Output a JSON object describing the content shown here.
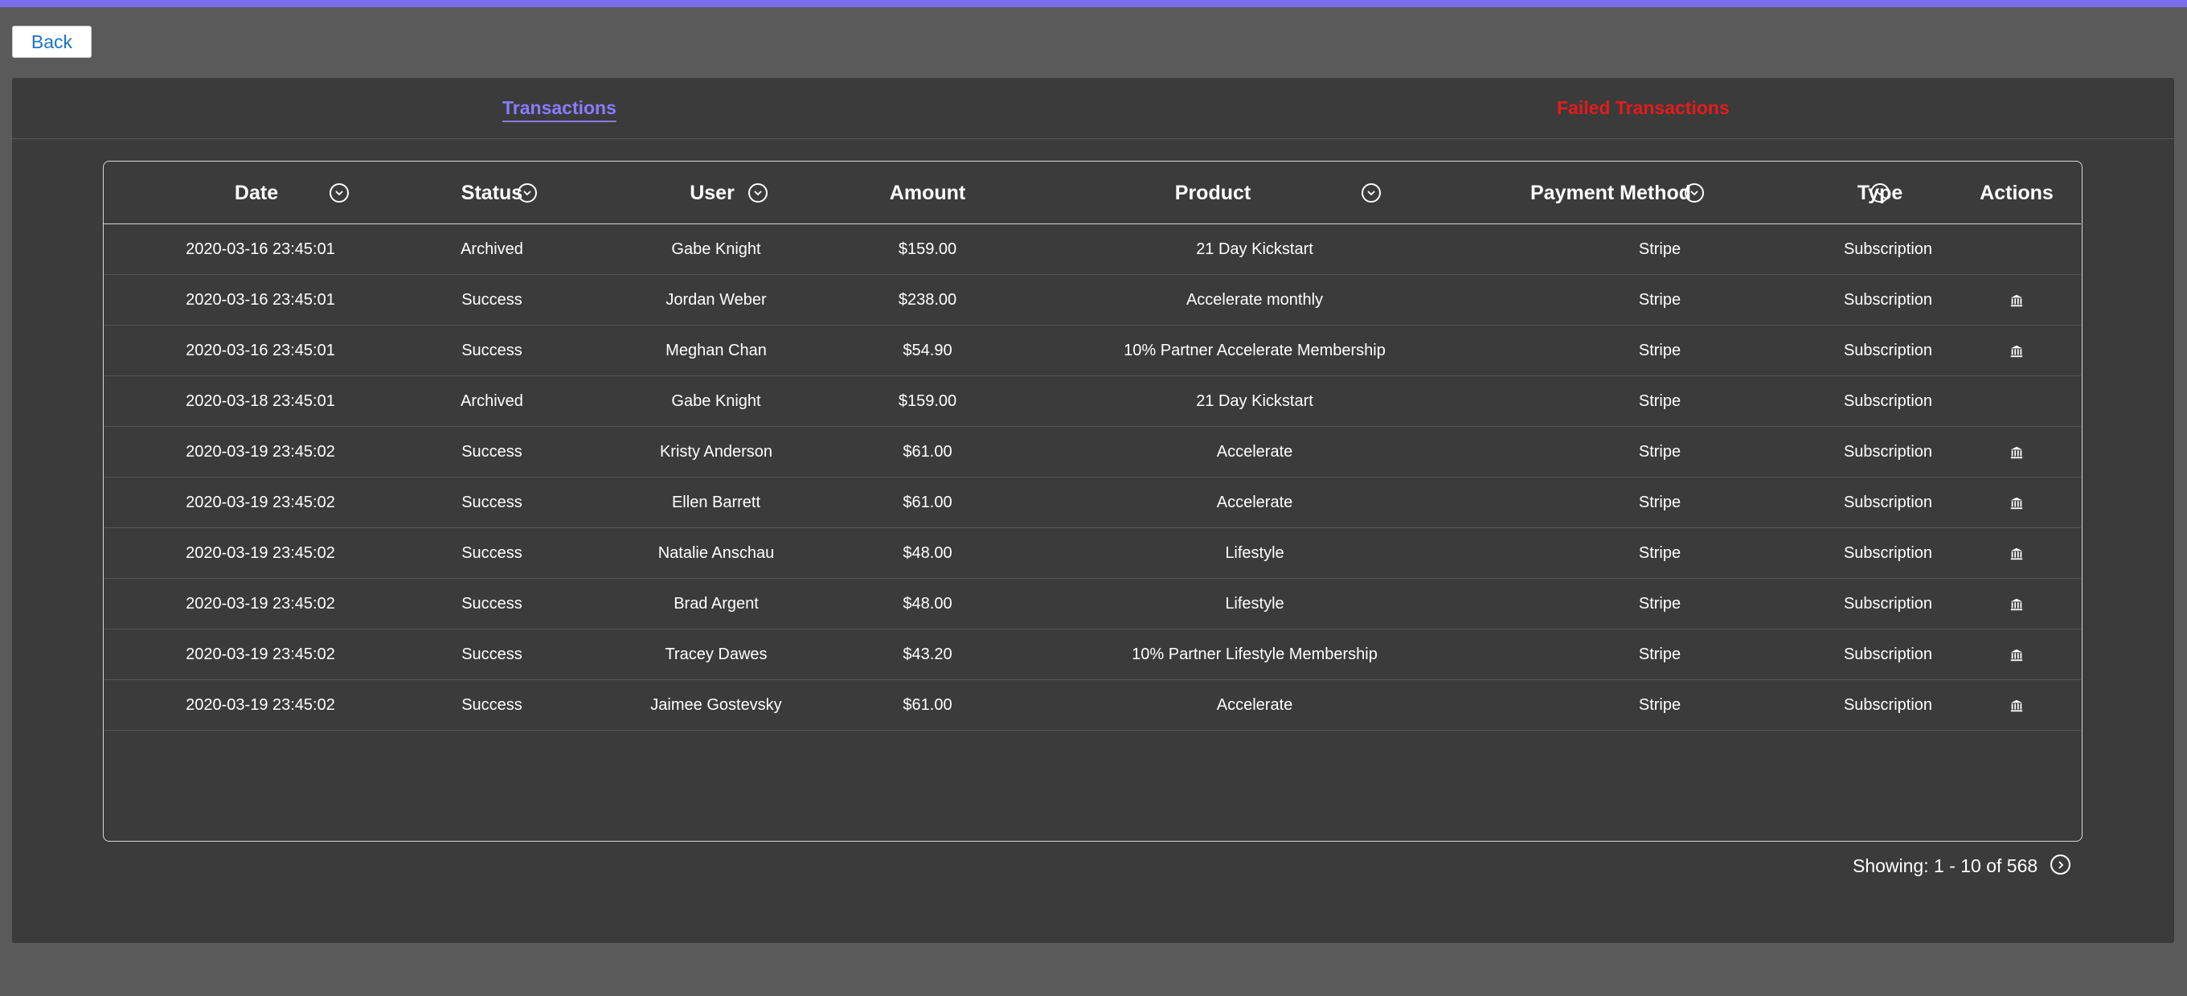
{
  "back_label": "Back",
  "tabs": [
    {
      "label": "Transactions",
      "active": true
    },
    {
      "label": "Failed Transactions",
      "active": false
    }
  ],
  "colors": {
    "accent": "#7b6cf0",
    "failed": "#e51b1b",
    "panel": "#3b3b3b",
    "page": "#5a5a5a"
  },
  "table": {
    "headers": {
      "date": "Date",
      "status": "Status",
      "user": "User",
      "amount": "Amount",
      "product": "Product",
      "payment_method": "Payment Method",
      "type": "Type",
      "actions": "Actions"
    },
    "sortable_icon": "chevron-down-circle-icon",
    "action_icon": "bank-icon",
    "rows": [
      {
        "date": "2020-03-16 23:45:01",
        "status": "Archived",
        "user": "Gabe Knight",
        "amount": "$159.00",
        "product": "21 Day Kickstart",
        "payment_method": "Stripe",
        "type": "Subscription",
        "has_action": false
      },
      {
        "date": "2020-03-16 23:45:01",
        "status": "Success",
        "user": "Jordan Weber",
        "amount": "$238.00",
        "product": "Accelerate monthly",
        "payment_method": "Stripe",
        "type": "Subscription",
        "has_action": true
      },
      {
        "date": "2020-03-16 23:45:01",
        "status": "Success",
        "user": "Meghan Chan",
        "amount": "$54.90",
        "product": "10% Partner Accelerate Membership",
        "payment_method": "Stripe",
        "type": "Subscription",
        "has_action": true
      },
      {
        "date": "2020-03-18 23:45:01",
        "status": "Archived",
        "user": "Gabe Knight",
        "amount": "$159.00",
        "product": "21 Day Kickstart",
        "payment_method": "Stripe",
        "type": "Subscription",
        "has_action": false
      },
      {
        "date": "2020-03-19 23:45:02",
        "status": "Success",
        "user": "Kristy Anderson",
        "amount": "$61.00",
        "product": "Accelerate",
        "payment_method": "Stripe",
        "type": "Subscription",
        "has_action": true
      },
      {
        "date": "2020-03-19 23:45:02",
        "status": "Success",
        "user": "Ellen Barrett",
        "amount": "$61.00",
        "product": "Accelerate",
        "payment_method": "Stripe",
        "type": "Subscription",
        "has_action": true
      },
      {
        "date": "2020-03-19 23:45:02",
        "status": "Success",
        "user": "Natalie Anschau",
        "amount": "$48.00",
        "product": "Lifestyle",
        "payment_method": "Stripe",
        "type": "Subscription",
        "has_action": true
      },
      {
        "date": "2020-03-19 23:45:02",
        "status": "Success",
        "user": "Brad Argent",
        "amount": "$48.00",
        "product": "Lifestyle",
        "payment_method": "Stripe",
        "type": "Subscription",
        "has_action": true
      },
      {
        "date": "2020-03-19 23:45:02",
        "status": "Success",
        "user": "Tracey Dawes",
        "amount": "$43.20",
        "product": "10% Partner Lifestyle Membership",
        "payment_method": "Stripe",
        "type": "Subscription",
        "has_action": true
      },
      {
        "date": "2020-03-19 23:45:02",
        "status": "Success",
        "user": "Jaimee Gostevsky",
        "amount": "$61.00",
        "product": "Accelerate",
        "payment_method": "Stripe",
        "type": "Subscription",
        "has_action": true
      }
    ]
  },
  "pagination": {
    "label": "Showing: 1 - 10 of 568"
  }
}
